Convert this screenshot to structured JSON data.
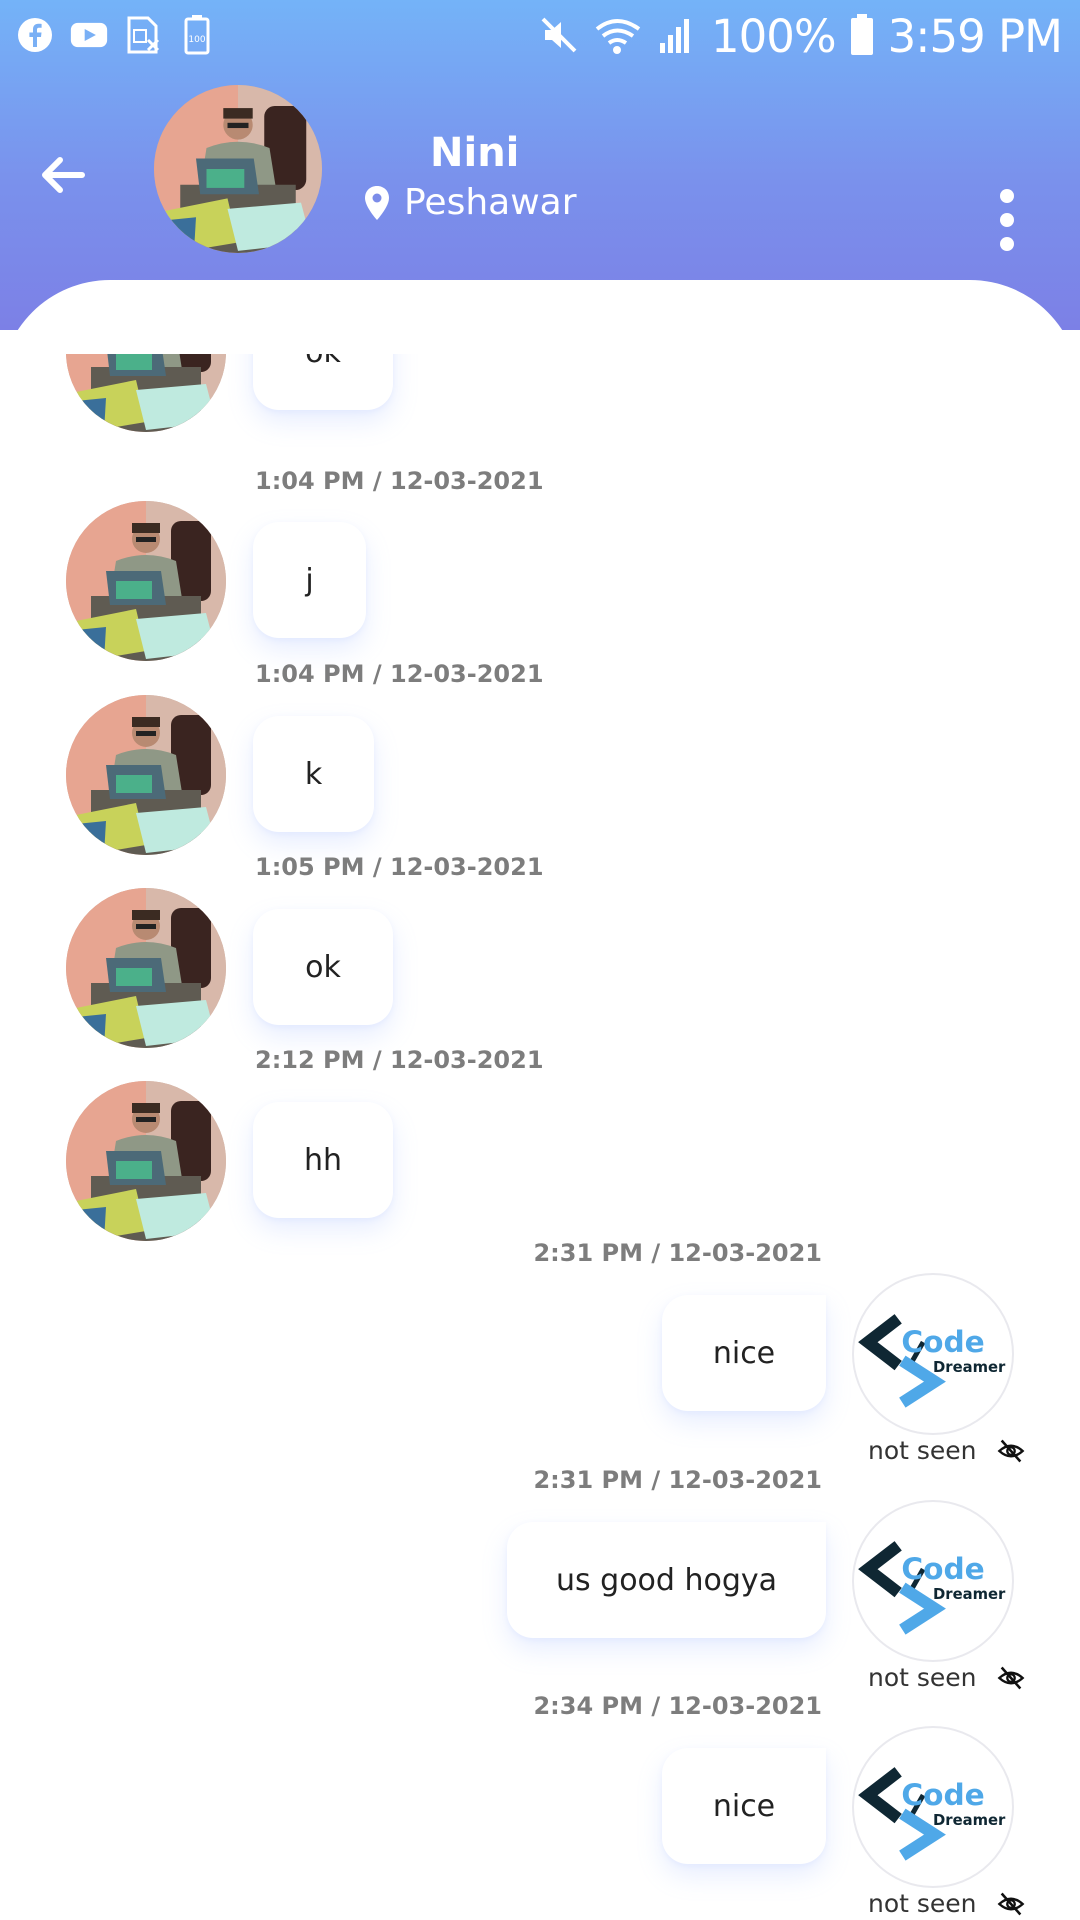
{
  "status_bar": {
    "battery": "100%",
    "time": "3:59 PM",
    "left_icons": [
      "facebook-icon",
      "youtube-icon",
      "sim-icon",
      "battery-saver-icon"
    ],
    "small_battery_label": "100"
  },
  "header": {
    "name": "Nini",
    "location": "Peshawar"
  },
  "messages": [
    {
      "text": "ok"
    },
    {
      "time": "1:04 PM / 12-03-2021",
      "text": "j"
    },
    {
      "time": "1:04 PM / 12-03-2021",
      "text": "k"
    },
    {
      "time": "1:05 PM / 12-03-2021",
      "text": "ok"
    },
    {
      "time": "2:12 PM / 12-03-2021",
      "text": "hh"
    },
    {
      "time": "2:31 PM / 12-03-2021",
      "text": "nice",
      "status": "not seen"
    },
    {
      "time": "2:31 PM / 12-03-2021",
      "text": "us good hogya",
      "status": "not seen"
    },
    {
      "time": "2:34 PM / 12-03-2021",
      "text": "nice",
      "status": "not seen"
    }
  ],
  "logo": {
    "line1": "Code",
    "line2": "Dreamer",
    "accent": "#4fa8e8",
    "dark": "#0f2733"
  },
  "colors": {
    "header_top": "#74b3f8",
    "header_bottom": "#7c80e6"
  }
}
